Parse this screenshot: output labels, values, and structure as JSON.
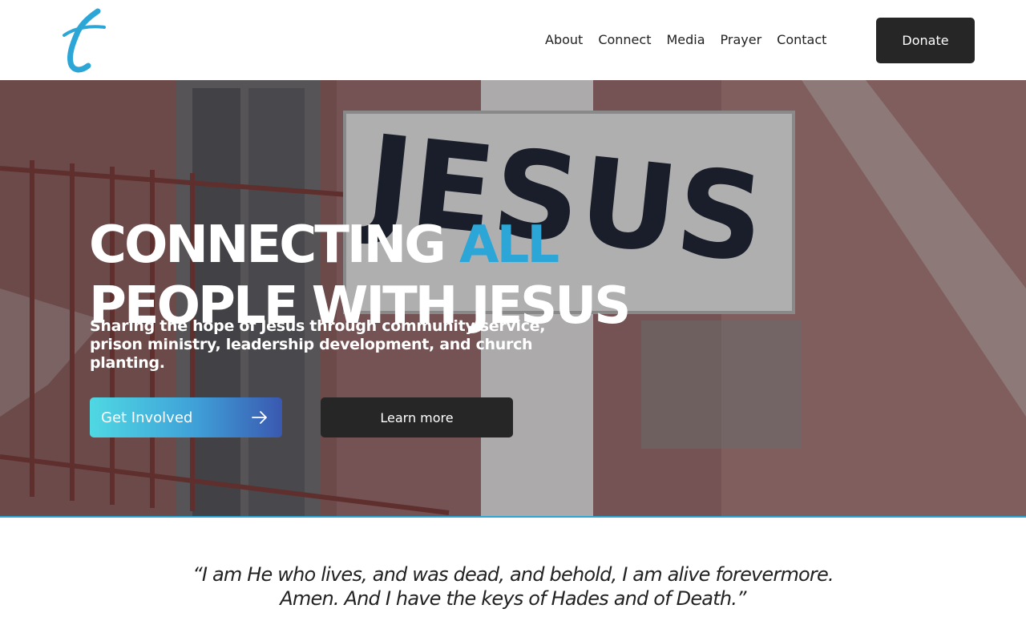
{
  "brand": {
    "logo_letter": "t",
    "accent_color": "#2ba6d6"
  },
  "nav": {
    "items": [
      {
        "label": "About"
      },
      {
        "label": "Connect"
      },
      {
        "label": "Media"
      },
      {
        "label": "Prayer"
      },
      {
        "label": "Contact"
      }
    ],
    "donate_label": "Donate"
  },
  "hero": {
    "sign_text": "JESUS",
    "title_line1_main": "CONNECTING ",
    "title_line1_accent": "ALL",
    "title_line2": "PEOPLE WITH JESUS",
    "subtitle": "Sharing the hope of Jesus through community service, prison ministry, leadership development, and church planting.",
    "primary_cta": "Get Involved",
    "secondary_cta": "Learn more",
    "arrow_icon": "arrow-right-icon"
  },
  "quote": {
    "line1": "“I am He who lives, and was dead,  and behold, I am alive forevermore.",
    "line2": "Amen. And I have the keys of Hades and of Death.”"
  }
}
